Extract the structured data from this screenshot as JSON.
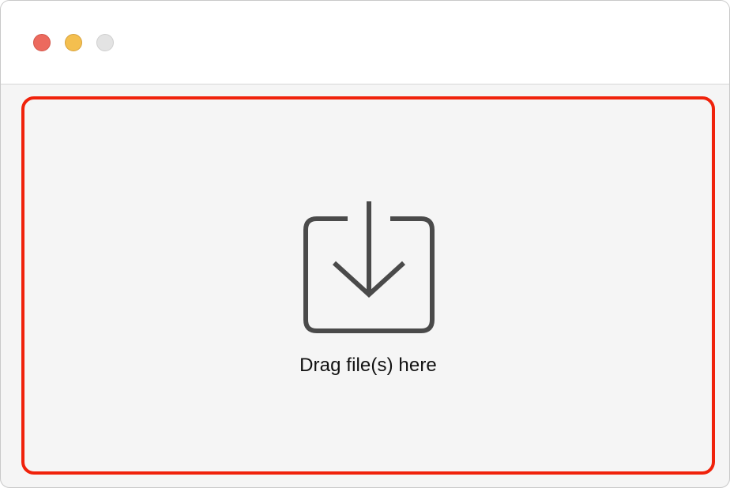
{
  "window": {
    "controls": {
      "close": {
        "icon": "close-dot",
        "color": "#ec6a5e",
        "border": "#d25549"
      },
      "minimize": {
        "icon": "minimize-dot",
        "color": "#f4bf4f",
        "border": "#d6a13c"
      },
      "zoom": {
        "icon": "zoom-dot",
        "color": "#e3e3e3",
        "border": "#cfcfcf"
      }
    }
  },
  "dropzone": {
    "icon": "tray-download-icon",
    "label": "Drag file(s) here",
    "border_color": "#f0220b",
    "icon_color": "#4a4a4a"
  }
}
